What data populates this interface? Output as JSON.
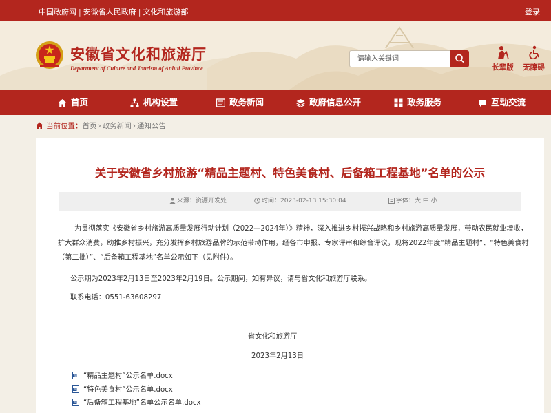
{
  "topbar": {
    "links": [
      "中国政府网",
      "安徽省人民政府",
      "文化和旅游部"
    ],
    "login": "登录"
  },
  "header": {
    "title": "安徽省文化和旅游厅",
    "subtitle": "Department of Culture and Tourism of Anhui Province",
    "search_placeholder": "请输入关键词",
    "elder_label": "长辈版",
    "access_label": "无障碍"
  },
  "nav": {
    "items": [
      {
        "label": "首页",
        "icon": "home-icon"
      },
      {
        "label": "机构设置",
        "icon": "org-icon"
      },
      {
        "label": "政务新闻",
        "icon": "news-icon"
      },
      {
        "label": "政府信息公开",
        "icon": "layers-icon"
      },
      {
        "label": "政务服务",
        "icon": "service-icon"
      },
      {
        "label": "互动交流",
        "icon": "chat-icon"
      }
    ]
  },
  "breadcrumb": {
    "label": "当前位置：",
    "items": [
      "首页",
      "政务新闻",
      "通知公告"
    ],
    "separator": "›"
  },
  "article": {
    "title": "关于安徽省乡村旅游“精品主题村、特色美食村、后备箱工程基地”名单的公示",
    "source": "来源：资源开发处",
    "time": "时间：2023-02-13 15:30:04",
    "font_size": "字体：大 中 小",
    "para1": "为贯彻落实《安徽省乡村旅游高质量发展行动计划（2022—2024年）》精神，深入推进乡村振兴战略和乡村旅游高质量发展，带动农民就业增收，扩大群众消费，助推乡村振兴，充分发挥乡村旅游品牌的示范带动作用，经各市申报、专家评审和综合评议，现将2022年度“精品主题村”、“特色美食村（第二批）”、“后备箱工程基地”名单公示如下（见附件）。",
    "para2": "公示期为2023年2月13日至2023年2月19日。公示期间，如有异议，请与省文化和旅游厅联系。",
    "phone": "联系电话：0551-63608297",
    "signature": "省文化和旅游厅",
    "date": "2023年2月13日",
    "attachments": [
      "“精品主题村”公示名单.docx",
      "“特色美食村”公示名单.docx",
      "“后备箱工程基地”名单公示名单.docx"
    ]
  },
  "colors": {
    "brand_red": "#b3261e",
    "page_bg": "#f3efe6",
    "meta_bg": "#efefef"
  }
}
